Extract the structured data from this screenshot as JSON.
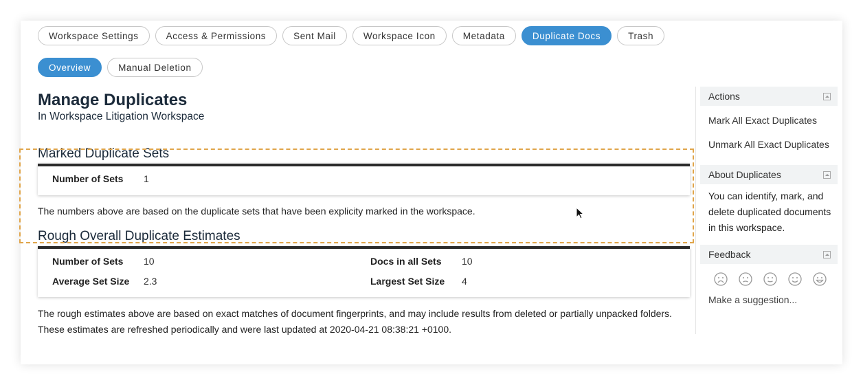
{
  "tabs": [
    {
      "label": "Workspace Settings",
      "active": false
    },
    {
      "label": "Access & Permissions",
      "active": false
    },
    {
      "label": "Sent Mail",
      "active": false
    },
    {
      "label": "Workspace Icon",
      "active": false
    },
    {
      "label": "Metadata",
      "active": false
    },
    {
      "label": "Duplicate Docs",
      "active": true
    },
    {
      "label": "Trash",
      "active": false
    }
  ],
  "subtabs": [
    {
      "label": "Overview",
      "active": true
    },
    {
      "label": "Manual Deletion",
      "active": false
    }
  ],
  "page": {
    "title": "Manage Duplicates",
    "subtitle": "In Workspace Litigation Workspace"
  },
  "marked": {
    "title": "Marked Duplicate Sets",
    "sets_label": "Number of Sets",
    "sets_value": "1",
    "note": "The numbers above are based on the duplicate sets that have been explicity marked in the workspace."
  },
  "rough": {
    "title": "Rough Overall Duplicate Estimates",
    "sets_label": "Number of Sets",
    "sets_value": "10",
    "docs_label": "Docs in all Sets",
    "docs_value": "10",
    "avg_label": "Average Set Size",
    "avg_value": "2.3",
    "largest_label": "Largest Set Size",
    "largest_value": "4",
    "note": "The rough estimates above are based on exact matches of document fingerprints, and may include results from deleted or partially unpacked folders. These estimates are refreshed periodically and were last updated at 2020-04-21 08:38:21 +0100."
  },
  "sidebar": {
    "actions_title": "Actions",
    "mark_all": "Mark All Exact Duplicates",
    "unmark_all": "Unmark All Exact Duplicates",
    "about_title": "About Duplicates",
    "about_text": "You can identify, mark, and delete duplicated documents in this workspace.",
    "feedback_title": "Feedback",
    "feedback_faces": [
      "very-unhappy-face-icon",
      "unhappy-face-icon",
      "neutral-face-icon",
      "happy-face-icon",
      "very-happy-face-icon"
    ],
    "suggestion": "Make a suggestion..."
  },
  "colors": {
    "accent": "#3b8fd1",
    "highlight_border": "#e0a54a"
  }
}
